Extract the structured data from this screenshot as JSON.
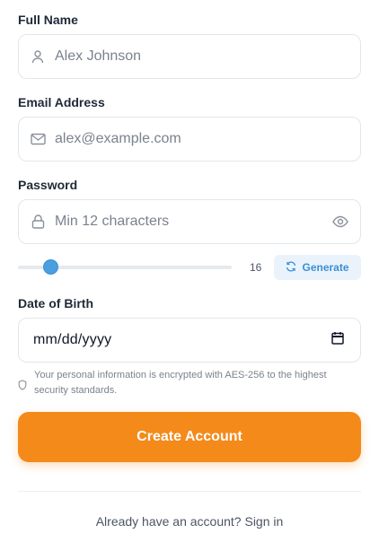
{
  "full_name": {
    "label": "Full Name",
    "placeholder": "Alex Johnson",
    "icon": "user-icon"
  },
  "email": {
    "label": "Email Address",
    "placeholder": "alex@example.com",
    "icon": "mail-icon"
  },
  "password": {
    "label": "Password",
    "placeholder": "Min 12 characters",
    "icon": "lock-icon",
    "toggle_icon": "eye-icon"
  },
  "password_generator": {
    "length": "16",
    "length_value": 16,
    "length_fraction": 0.13,
    "generate_label": "Generate",
    "generate_icon": "refresh-icon"
  },
  "date_of_birth": {
    "label": "Date of Birth",
    "value": "mm/dd/yyyy",
    "icon": "calendar-icon"
  },
  "security_note": {
    "icon": "shield-icon",
    "text": "Your personal information is encrypted with AES-256 to the highest security standards."
  },
  "submit": {
    "label": "Create Account"
  },
  "footer": {
    "prompt": "Already have an account?",
    "link": "Sign in"
  },
  "colors": {
    "accent_orange": "#f48a1a",
    "accent_blue": "#4a9fe0",
    "generate_bg": "#eaf3fb",
    "border": "#e3e6ea"
  }
}
